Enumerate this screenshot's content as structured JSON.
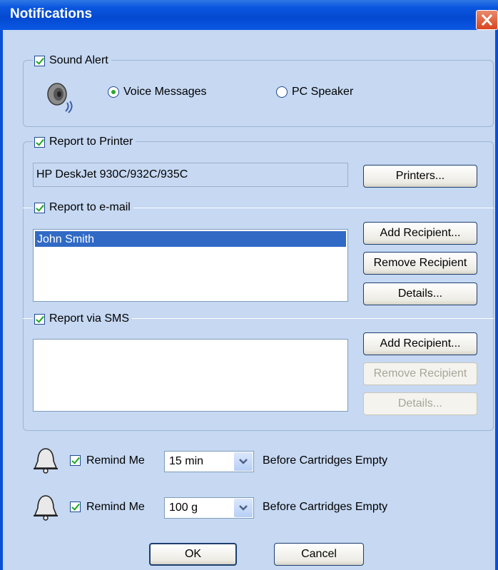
{
  "window": {
    "title": "Notifications"
  },
  "sound_alert": {
    "label": "Sound Alert",
    "checked": true,
    "options": [
      {
        "label": "Voice Messages",
        "selected": true
      },
      {
        "label": "PC Speaker",
        "selected": false
      }
    ],
    "icon": "speaker-icon"
  },
  "printer": {
    "label": "Report to Printer",
    "checked": true,
    "name": "HP DeskJet 930C/932C/935C",
    "button": "Printers..."
  },
  "email": {
    "label": "Report to e-mail",
    "checked": true,
    "recipients": [
      "John Smith"
    ],
    "buttons": {
      "add": "Add Recipient...",
      "remove": "Remove Recipient",
      "details": "Details..."
    }
  },
  "sms": {
    "label": "Report via SMS",
    "checked": true,
    "recipients": [],
    "buttons": {
      "add": "Add Recipient...",
      "remove": "Remove Recipient",
      "details": "Details..."
    }
  },
  "reminders": [
    {
      "label": "Remind Me",
      "checked": true,
      "value": "15 min",
      "suffix": "Before Cartridges Empty",
      "icon": "bell-icon"
    },
    {
      "label": "Remind Me",
      "checked": true,
      "value": "100 g",
      "suffix": "Before Cartridges Empty",
      "icon": "bell-icon"
    }
  ],
  "footer": {
    "ok": "OK",
    "cancel": "Cancel"
  },
  "colors": {
    "title_bar": "#0449d0",
    "dialog_bg": "#c6d8f2",
    "selection": "#316ac5"
  }
}
